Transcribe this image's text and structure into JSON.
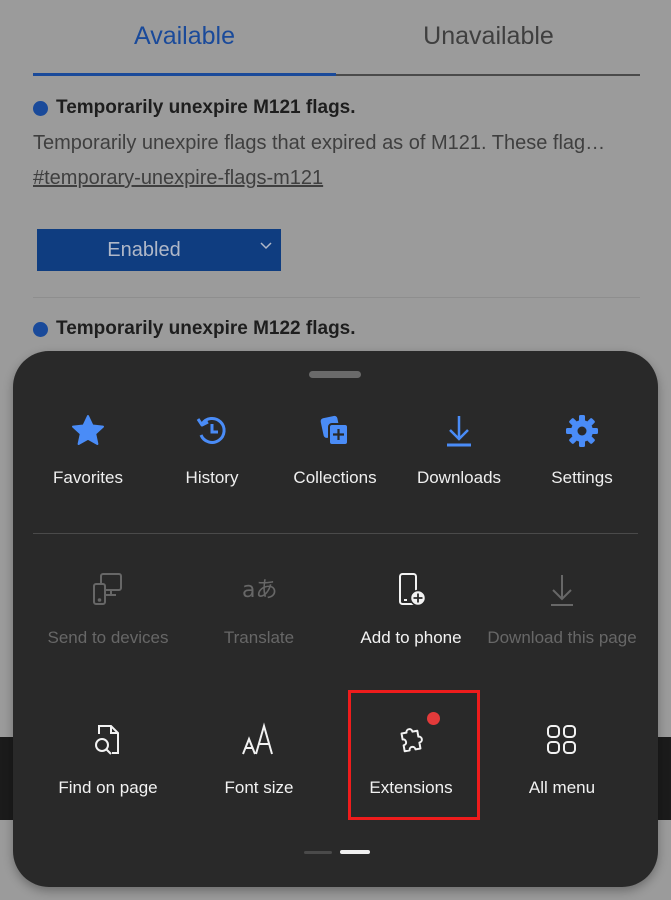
{
  "background_page": {
    "tabs": [
      {
        "label": "Available",
        "active": true
      },
      {
        "label": "Unavailable",
        "active": false
      }
    ],
    "flags": [
      {
        "title": "Temporarily unexpire M121 flags.",
        "description": "Temporarily unexpire flags that expired as of M121. These flag…",
        "link": "#temporary-unexpire-flags-m121",
        "select_value": "Enabled"
      },
      {
        "title": "Temporarily unexpire M122 flags."
      }
    ]
  },
  "menu_sheet": {
    "quick_actions": [
      {
        "label": "Favorites",
        "icon": "star-icon"
      },
      {
        "label": "History",
        "icon": "history-icon"
      },
      {
        "label": "Collections",
        "icon": "collections-icon"
      },
      {
        "label": "Downloads",
        "icon": "download-icon"
      },
      {
        "label": "Settings",
        "icon": "gear-icon"
      }
    ],
    "grid_items": [
      {
        "label": "Send to devices",
        "icon": "send-to-devices-icon",
        "enabled": false
      },
      {
        "label": "Translate",
        "icon": "translate-icon",
        "enabled": false
      },
      {
        "label": "Add to phone",
        "icon": "add-to-phone-icon",
        "enabled": true
      },
      {
        "label": "Download this page",
        "icon": "download-page-icon",
        "enabled": false
      },
      {
        "label": "Find on page",
        "icon": "find-on-page-icon",
        "enabled": true
      },
      {
        "label": "Font size",
        "icon": "font-size-icon",
        "enabled": true
      },
      {
        "label": "Extensions",
        "icon": "puzzle-icon",
        "enabled": true,
        "badge": true,
        "highlighted": true
      },
      {
        "label": "All menu",
        "icon": "grid-icon",
        "enabled": true
      }
    ],
    "pager": {
      "pages": 2,
      "current": 2
    }
  },
  "colors": {
    "accent_blue": "#4a8cf7",
    "badge_red": "#e33a3a",
    "highlight_red": "#ee1c1c",
    "sheet_bg": "#292929"
  }
}
